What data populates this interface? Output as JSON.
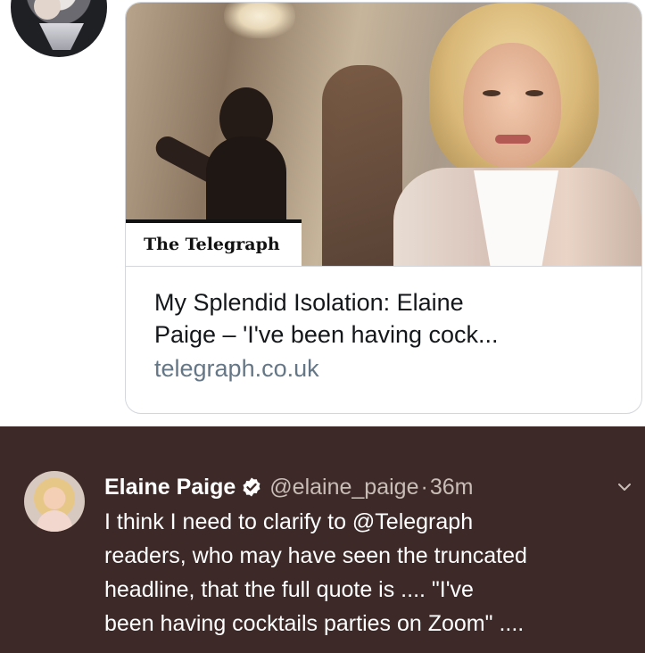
{
  "card": {
    "source": "The Telegraph",
    "title_line1": "My Splendid Isolation: Elaine",
    "title_line2": "Paige – 'I've been having cock...",
    "domain": "telegraph.co.uk"
  },
  "tweet": {
    "name": "Elaine Paige",
    "handle": "@elaine_paige",
    "separator": "·",
    "time": "36m",
    "lines": [
      "I think I need to clarify to @Telegraph",
      "readers, who may have seen the truncated",
      "headline, that the full quote is .... \"I've",
      "been having cocktails parties on Zoom\" ...."
    ]
  },
  "colors": {
    "tweet_bg": "#3d2a28",
    "verified": "#ffffff",
    "domain_text": "#657786"
  }
}
